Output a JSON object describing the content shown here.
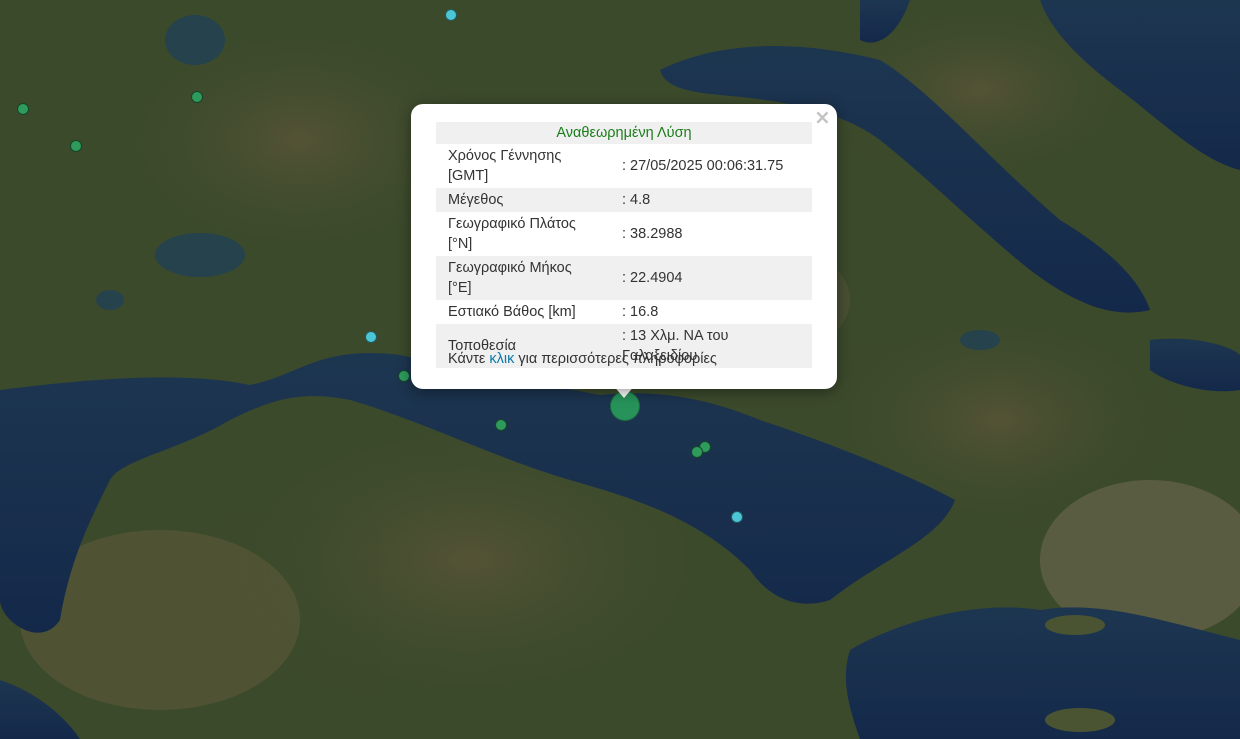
{
  "popup": {
    "title": "Αναθεωρημένη Λύση",
    "close_icon": "×",
    "rows": [
      {
        "label": "Χρόνος Γέννησης [GMT]",
        "value": ": 27/05/2025 00:06:31.75"
      },
      {
        "label": "Μέγεθος",
        "value": ": 4.8"
      },
      {
        "label": "Γεωγραφικό Πλάτος [°N]",
        "value": ": 38.2988"
      },
      {
        "label": "Γεωγραφικό Μήκος [°E]",
        "value": ": 22.4904"
      },
      {
        "label": "Εστιακό Βάθος [km]",
        "value": ": 16.8"
      },
      {
        "label": "Τοποθεσία",
        "value": ": 13 Χλμ. ΝΑ του Γαλαξειδίου"
      }
    ],
    "more_prefix": "Κάντε",
    "more_link": "κλικ",
    "more_suffix": "για περισσότερες πληροφορίες"
  },
  "colors": {
    "marker_green": "#2e9a5c",
    "marker_cyan": "#4cc6d6",
    "title_green": "#1a7d1a",
    "link_blue": "#0b7aa8"
  }
}
